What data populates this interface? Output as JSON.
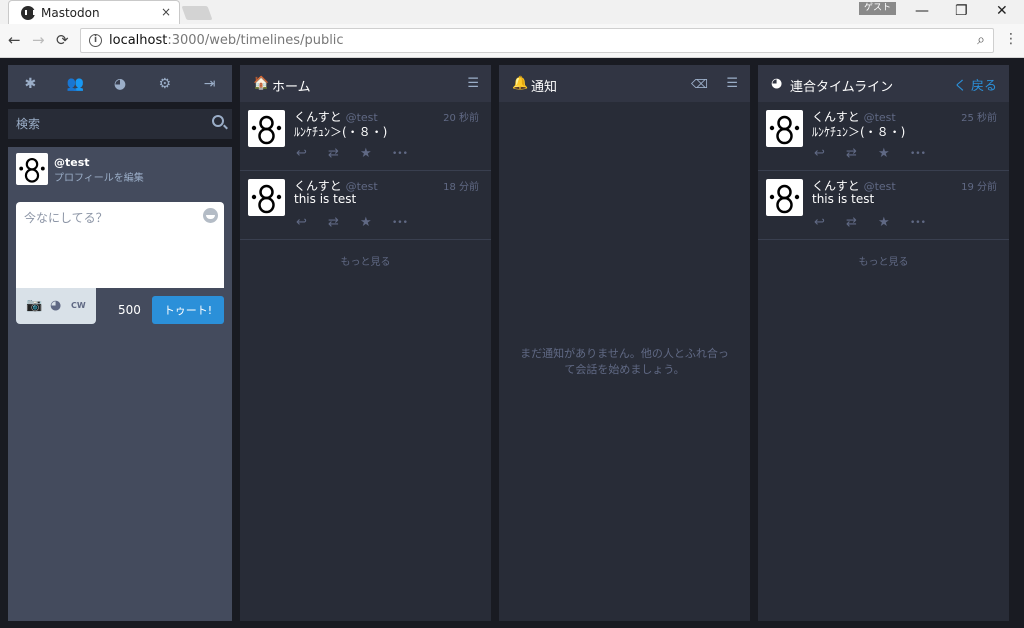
{
  "browser": {
    "tab_title": "Mastodon",
    "tab_close": "×",
    "guest_label": "ゲスト",
    "url_host": "localhost",
    "url_path": ":3000/web/timelines/public",
    "win_minimize": "—",
    "win_restore": "❐",
    "win_close": "✕",
    "back": "←",
    "forward": "→",
    "reload": "⟳",
    "info": "i",
    "zoom": "⌕",
    "menu": "⋮"
  },
  "drawer": {
    "header_icons": [
      {
        "name": "getting-started-icon",
        "glyph": "✱"
      },
      {
        "name": "community-icon",
        "glyph": "👥"
      },
      {
        "name": "public-globe-icon",
        "glyph": "◕"
      },
      {
        "name": "settings-gear-icon",
        "glyph": "⚙"
      },
      {
        "name": "logout-icon",
        "glyph": "⇥"
      }
    ],
    "search_placeholder": "検索",
    "account": "@test",
    "edit_profile": "プロフィールを編集",
    "compose_placeholder": "今なにしてる？",
    "camera_icon": "📷",
    "privacy_icon": "◕",
    "cw_label": "CW",
    "counter": "500",
    "toot_label": "トゥート!"
  },
  "columns": {
    "home": {
      "icon": "🏠",
      "title": "ホーム",
      "settings_icon": "☰",
      "statuses": [
        {
          "display_name": "くんすと",
          "acct": "@test",
          "time": "20 秒前",
          "content": "ﾙﾝｹﾁｭﾝ＞(・８・)"
        },
        {
          "display_name": "くんすと",
          "acct": "@test",
          "time": "18 分前",
          "content": "this is test"
        }
      ],
      "load_more": "もっと見る"
    },
    "notifications": {
      "icon": "🔔",
      "title": "通知",
      "clear_icon": "⌫",
      "settings_icon": "☰",
      "empty": "まだ通知がありません。他の人とふれ合って会話を始めましょう。"
    },
    "federated": {
      "icon": "◕",
      "title": "連合タイムライン",
      "back_label": "く 戻る",
      "statuses": [
        {
          "display_name": "くんすと",
          "acct": "@test",
          "time": "25 秒前",
          "content": "ﾙﾝｹﾁｭﾝ＞(・８・)"
        },
        {
          "display_name": "くんすと",
          "acct": "@test",
          "time": "19 分前",
          "content": "this is test"
        }
      ],
      "load_more": "もっと見る"
    }
  },
  "actions": {
    "reply": "↩",
    "boost": "⇄",
    "favourite": "★",
    "more": "•••"
  },
  "colors": {
    "accent": "#2b90d9",
    "background": "#191b22",
    "column": "#282c37",
    "muted": "#606984"
  }
}
